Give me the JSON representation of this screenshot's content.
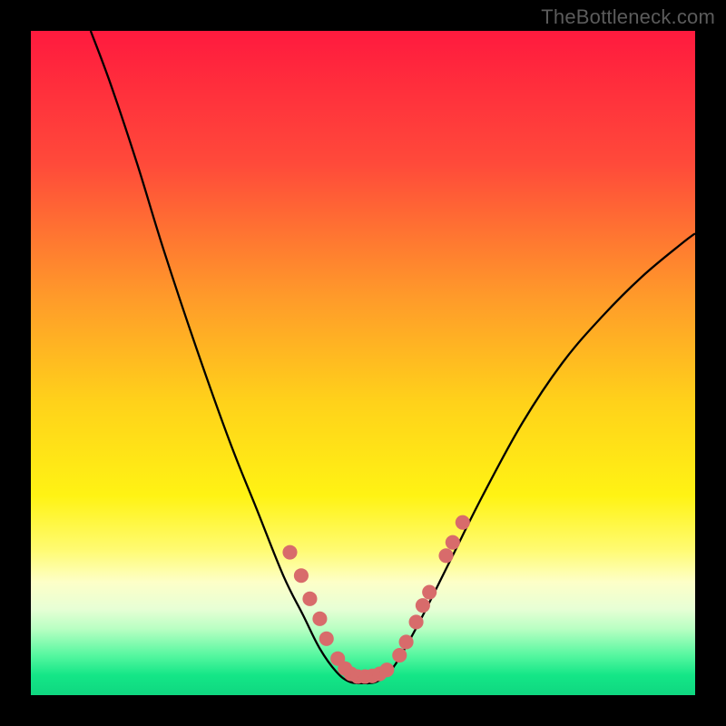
{
  "watermark": "TheBottleneck.com",
  "chart_data": {
    "type": "line",
    "title": "",
    "xlabel": "",
    "ylabel": "",
    "xlim": [
      0,
      100
    ],
    "ylim": [
      0,
      100
    ],
    "grid": false,
    "legend": "none",
    "gradient_stops": [
      {
        "pos": 0.0,
        "color": "#ff1a3e"
      },
      {
        "pos": 0.2,
        "color": "#ff4a3a"
      },
      {
        "pos": 0.4,
        "color": "#ff9a2a"
      },
      {
        "pos": 0.56,
        "color": "#ffd21a"
      },
      {
        "pos": 0.7,
        "color": "#fff314"
      },
      {
        "pos": 0.78,
        "color": "#fffb70"
      },
      {
        "pos": 0.83,
        "color": "#fdffc8"
      },
      {
        "pos": 0.87,
        "color": "#e7ffd5"
      },
      {
        "pos": 0.9,
        "color": "#b9ffc3"
      },
      {
        "pos": 0.94,
        "color": "#56f7a0"
      },
      {
        "pos": 0.97,
        "color": "#14e687"
      },
      {
        "pos": 1.0,
        "color": "#0fd780"
      }
    ],
    "series": [
      {
        "name": "bottleneck-curve",
        "stroke": "#000000",
        "points": [
          {
            "x": 9.0,
            "y": 100.0
          },
          {
            "x": 12.0,
            "y": 92.0
          },
          {
            "x": 16.0,
            "y": 80.0
          },
          {
            "x": 20.0,
            "y": 67.0
          },
          {
            "x": 25.0,
            "y": 52.0
          },
          {
            "x": 30.0,
            "y": 38.0
          },
          {
            "x": 34.0,
            "y": 28.0
          },
          {
            "x": 38.0,
            "y": 18.0
          },
          {
            "x": 41.0,
            "y": 12.0
          },
          {
            "x": 43.5,
            "y": 7.0
          },
          {
            "x": 46.0,
            "y": 3.5
          },
          {
            "x": 48.0,
            "y": 2.0
          },
          {
            "x": 50.0,
            "y": 1.8
          },
          {
            "x": 52.0,
            "y": 2.0
          },
          {
            "x": 54.0,
            "y": 3.5
          },
          {
            "x": 56.0,
            "y": 6.5
          },
          {
            "x": 59.0,
            "y": 12.0
          },
          {
            "x": 63.0,
            "y": 20.0
          },
          {
            "x": 68.0,
            "y": 30.0
          },
          {
            "x": 74.0,
            "y": 41.0
          },
          {
            "x": 80.0,
            "y": 50.0
          },
          {
            "x": 86.0,
            "y": 57.0
          },
          {
            "x": 92.0,
            "y": 63.0
          },
          {
            "x": 98.0,
            "y": 68.0
          },
          {
            "x": 100.0,
            "y": 69.5
          }
        ]
      }
    ],
    "dots": {
      "color": "#d86b6b",
      "radius_pct": 1.1,
      "points": [
        {
          "x": 39.0,
          "y": 21.5
        },
        {
          "x": 40.7,
          "y": 18.0
        },
        {
          "x": 42.0,
          "y": 14.5
        },
        {
          "x": 43.5,
          "y": 11.5
        },
        {
          "x": 44.5,
          "y": 8.5
        },
        {
          "x": 46.2,
          "y": 5.5
        },
        {
          "x": 47.3,
          "y": 4.0
        },
        {
          "x": 48.2,
          "y": 3.2
        },
        {
          "x": 49.2,
          "y": 2.8
        },
        {
          "x": 50.3,
          "y": 2.8
        },
        {
          "x": 51.4,
          "y": 2.9
        },
        {
          "x": 52.5,
          "y": 3.2
        },
        {
          "x": 53.6,
          "y": 3.8
        },
        {
          "x": 55.5,
          "y": 6.0
        },
        {
          "x": 56.5,
          "y": 8.0
        },
        {
          "x": 58.0,
          "y": 11.0
        },
        {
          "x": 59.0,
          "y": 13.5
        },
        {
          "x": 60.0,
          "y": 15.5
        },
        {
          "x": 62.5,
          "y": 21.0
        },
        {
          "x": 63.5,
          "y": 23.0
        },
        {
          "x": 65.0,
          "y": 26.0
        }
      ]
    }
  }
}
